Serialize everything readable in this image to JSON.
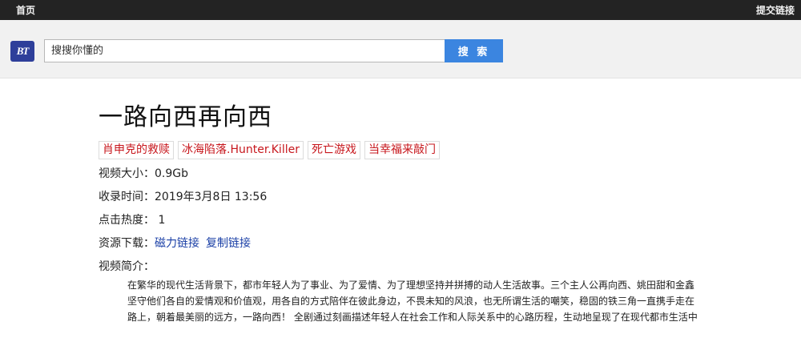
{
  "topbar": {
    "home": "首页",
    "submit_link": "提交链接"
  },
  "search": {
    "logo_text": "BT",
    "placeholder": "搜搜你懂的",
    "button": "搜 索"
  },
  "movie": {
    "title": "一路向西再向西",
    "tags": [
      "肖申克的救赎",
      "冰海陷落.Hunter.Killer",
      "死亡游戏",
      "当幸福来敲门"
    ],
    "size_label": "视频大小：",
    "size": "0.9Gb",
    "date_label": "收录时间：",
    "date": "2019年3月8日 13:56",
    "hot_label": "点击热度：",
    "hot": "1",
    "download_label": "资源下载：",
    "magnet": "磁力链接",
    "copy": "复制链接",
    "intro_label": "视频简介：",
    "intro": "在繁华的现代生活背景下，都市年轻人为了事业、为了爱情、为了理想坚持并拼搏的动人生活故事。三个主人公再向西、姚田甜和金鑫坚守他们各自的爱情观和价值观，用各自的方式陪伴在彼此身边，不畏未知的风浪，也无所谓生活的嘲笑，稳固的铁三角一直携手走在路上，朝着最美丽的远方，一路向西！ 全剧通过刻画描述年轻人在社会工作和人际关系中的心路历程，生动地呈现了在现代都市生活中"
  }
}
